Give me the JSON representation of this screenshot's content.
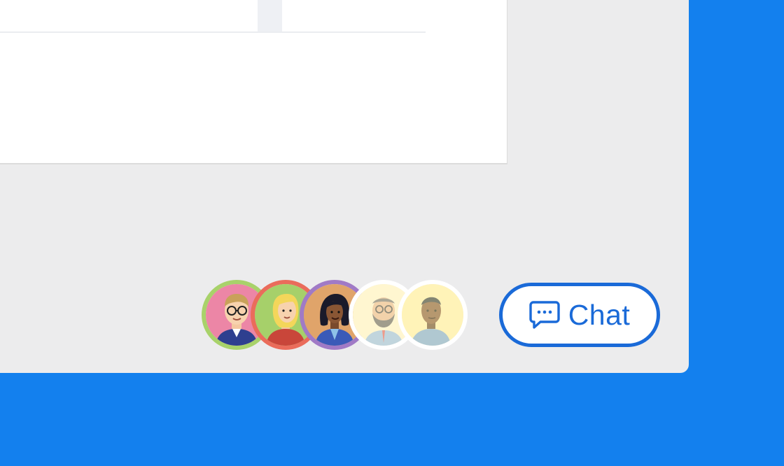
{
  "chat": {
    "label": "Chat",
    "icon": "chat-bubble-icon"
  },
  "participants": [
    {
      "name": "participant-1",
      "ring": "#a8d26a",
      "bg": "#ec86a6",
      "faded": false
    },
    {
      "name": "participant-2",
      "ring": "#ea6c5b",
      "bg": "#a6d06a",
      "faded": false
    },
    {
      "name": "participant-3",
      "ring": "#a07ac6",
      "bg": "#e0a46a",
      "faded": false
    },
    {
      "name": "participant-4",
      "ring": "#ffffff",
      "bg": "#fff6d0",
      "faded": true
    },
    {
      "name": "participant-5",
      "ring": "#ffffff",
      "bg": "#fff3b8",
      "faded": true
    }
  ],
  "colors": {
    "desktop": "#1380ee",
    "window": "#ececed",
    "accent": "#1a6ad8"
  }
}
